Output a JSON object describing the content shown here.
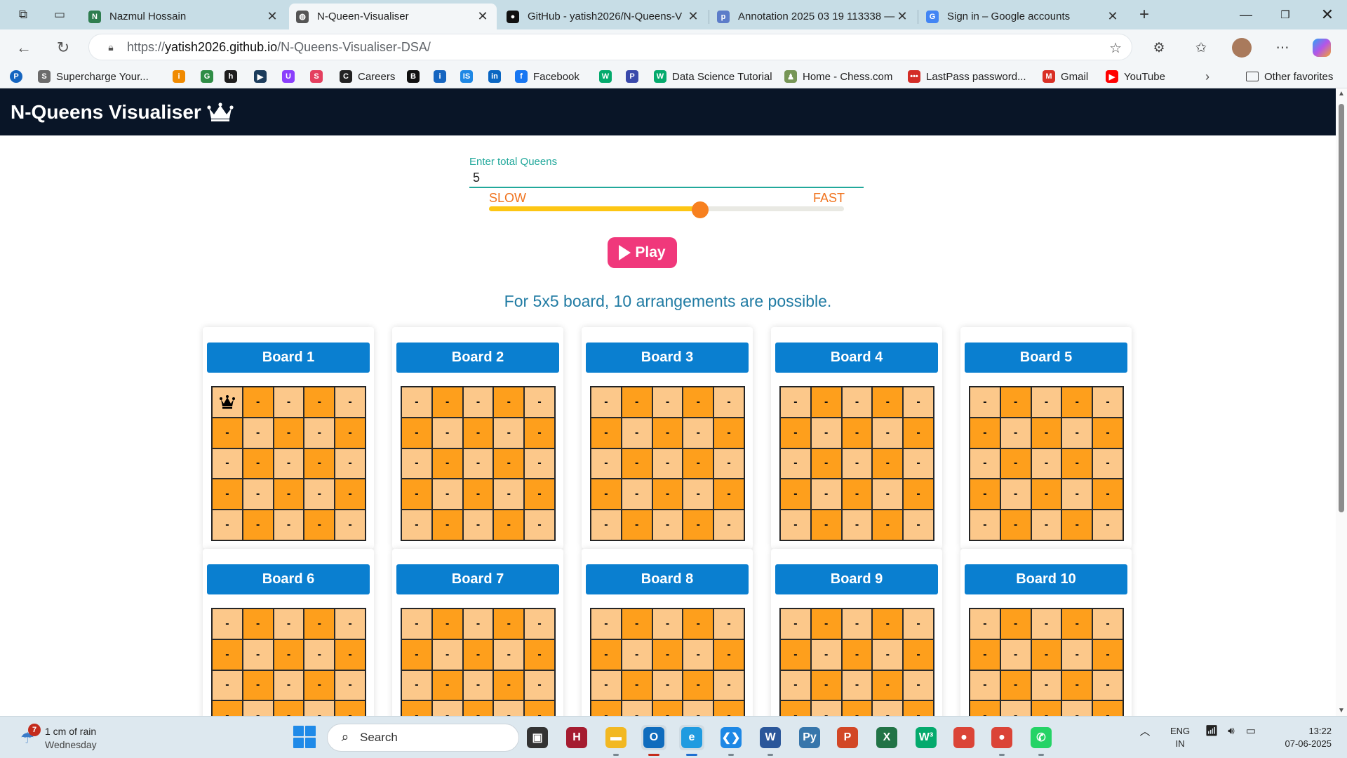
{
  "browser": {
    "tabs": [
      {
        "label": "Nazmul Hossain",
        "icon": "tab-icon-nazmul",
        "color": "#2e7d4f",
        "glyph": "N",
        "active": false
      },
      {
        "label": "N-Queen-Visualiser",
        "icon": "globe-icon",
        "color": "#555555",
        "glyph": "◍",
        "active": true
      },
      {
        "label": "GitHub - yatish2026/N-Queens-V",
        "icon": "github-icon",
        "color": "#111111",
        "glyph": "●",
        "active": false
      },
      {
        "label": "Annotation 2025 03 19 113338 —",
        "icon": "annotation-icon",
        "color": "#5c7cc9",
        "glyph": "p",
        "active": false
      },
      {
        "label": "Sign in – Google accounts",
        "icon": "google-icon",
        "color": "#4285f4",
        "glyph": "G",
        "active": false
      }
    ],
    "url_prefix": "https://",
    "url_host": "yatish2026.github.io",
    "url_path": "/N-Queens-Visualiser-DSA/",
    "bookmarks": [
      {
        "label": "Supercharge Your...",
        "icon": "supercharge-icon",
        "color": "#6b6b6b",
        "glyph": "S"
      },
      {
        "label": "",
        "icon": "bookmark-i-icon",
        "color": "#f08a00",
        "glyph": "i"
      },
      {
        "label": "",
        "icon": "geeksforgeeks-icon",
        "color": "#2f8d46",
        "glyph": "G"
      },
      {
        "label": "",
        "icon": "hackerrank-icon",
        "color": "#1d1d1d",
        "glyph": "h"
      },
      {
        "label": "",
        "icon": "bookmark-play-icon",
        "color": "#1b3c5c",
        "glyph": "▶"
      },
      {
        "label": "",
        "icon": "bookmark-u-icon",
        "color": "#8a3ffc",
        "glyph": "U"
      },
      {
        "label": "",
        "icon": "bookmark-swirl-icon",
        "color": "#e4405f",
        "glyph": "S"
      },
      {
        "label": "Careers",
        "icon": "careers-icon",
        "color": "#222222",
        "glyph": "C"
      },
      {
        "label": "",
        "icon": "bookmark-b-icon",
        "color": "#111111",
        "glyph": "B"
      },
      {
        "label": "",
        "icon": "info-icon",
        "color": "#1565c0",
        "glyph": "i"
      },
      {
        "label": "",
        "icon": "bookmark-is-icon",
        "color": "#1e88e5",
        "glyph": "IS"
      },
      {
        "label": "",
        "icon": "linkedin-icon",
        "color": "#0a66c2",
        "glyph": "in"
      },
      {
        "label": "Facebook",
        "icon": "facebook-icon",
        "color": "#1877f2",
        "glyph": "f"
      },
      {
        "label": "",
        "icon": "w3schools-icon",
        "color": "#04aa6d",
        "glyph": "W"
      },
      {
        "label": "",
        "icon": "bookmark-p-icon",
        "color": "#3949ab",
        "glyph": "P"
      },
      {
        "label": "Data Science Tutorial",
        "icon": "w3schools-icon",
        "color": "#04aa6d",
        "glyph": "W"
      },
      {
        "label": "Home - Chess.com",
        "icon": "chess-icon",
        "color": "#769656",
        "glyph": "♟"
      },
      {
        "label": "LastPass password...",
        "icon": "lastpass-icon",
        "color": "#d32d27",
        "glyph": "•••"
      },
      {
        "label": "Gmail",
        "icon": "gmail-icon",
        "color": "#d93025",
        "glyph": "M"
      },
      {
        "label": "YouTube",
        "icon": "youtube-icon",
        "color": "#ff0000",
        "glyph": "▶"
      }
    ],
    "other_favorites": "Other favorites"
  },
  "app": {
    "title": "N-Queens Visualiser",
    "queens_label": "Enter total Queens",
    "queens_value": "5",
    "slow_label": "SLOW",
    "fast_label": "FAST",
    "speed_fraction": 0.595,
    "play_label": "Play",
    "result_text": "For 5x5 board, 10 arrangements are possible.",
    "board_size": 5,
    "boards": [
      {
        "title": "Board 1",
        "queens": [
          [
            0,
            0
          ]
        ]
      },
      {
        "title": "Board 2",
        "queens": []
      },
      {
        "title": "Board 3",
        "queens": []
      },
      {
        "title": "Board 4",
        "queens": []
      },
      {
        "title": "Board 5",
        "queens": []
      },
      {
        "title": "Board 6",
        "queens": []
      },
      {
        "title": "Board 7",
        "queens": []
      },
      {
        "title": "Board 8",
        "queens": []
      },
      {
        "title": "Board 9",
        "queens": []
      },
      {
        "title": "Board 10",
        "queens": []
      }
    ],
    "empty_cell": "-",
    "colors": {
      "header_bg": "#091527",
      "board_header": "#0a7fd0",
      "light_cell": "#fcc88a",
      "dark_cell": "#fe9f1c",
      "play": "#f0387b",
      "accent": "#21a89b"
    }
  },
  "taskbar": {
    "weather_badge": "7",
    "weather_main": "1 cm of rain",
    "weather_sub": "Wednesday",
    "search_placeholder": "Search",
    "apps": [
      {
        "name": "task-view-app",
        "glyph": "▣",
        "color": "#333333"
      },
      {
        "name": "harvard-app",
        "glyph": "H",
        "color": "#a51c30"
      },
      {
        "name": "file-explorer-app",
        "glyph": "▬",
        "color": "#f2b822"
      },
      {
        "name": "outlook-app",
        "glyph": "O",
        "color": "#0f6cbd"
      },
      {
        "name": "edge-app",
        "glyph": "e",
        "color": "#1f9be0"
      },
      {
        "name": "vscode-app",
        "glyph": "❮❯",
        "color": "#1e88e5"
      },
      {
        "name": "word-app",
        "glyph": "W",
        "color": "#2b579a"
      },
      {
        "name": "python-app",
        "glyph": "Py",
        "color": "#3776ab"
      },
      {
        "name": "powerpoint-app",
        "glyph": "P",
        "color": "#d24726"
      },
      {
        "name": "excel-app",
        "glyph": "X",
        "color": "#217346"
      },
      {
        "name": "w3-app",
        "glyph": "W³",
        "color": "#04aa6d"
      },
      {
        "name": "chrome-app",
        "glyph": "●",
        "color": "#db4437"
      },
      {
        "name": "chrome-profile-app",
        "glyph": "●",
        "color": "#db4437"
      },
      {
        "name": "whatsapp-app",
        "glyph": "✆",
        "color": "#25d366"
      }
    ],
    "lang_top": "ENG",
    "lang_bottom": "IN",
    "time": "13:22",
    "date": "07-06-2025"
  }
}
